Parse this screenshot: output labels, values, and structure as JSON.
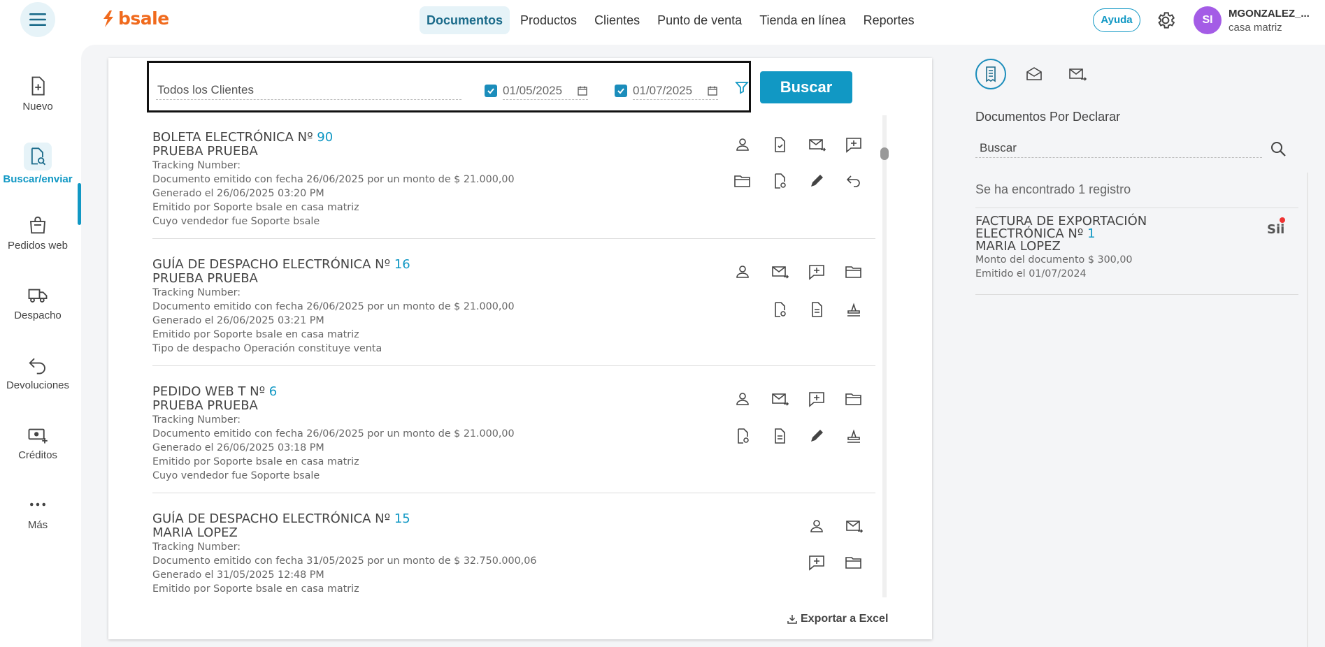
{
  "brand": {
    "logo_text": "bsale",
    "accent": "#1198c4",
    "logo_color": "#f06a1d"
  },
  "topnav": {
    "items": [
      {
        "label": "Documentos",
        "active": true
      },
      {
        "label": "Productos"
      },
      {
        "label": "Clientes"
      },
      {
        "label": "Punto de venta"
      },
      {
        "label": "Tienda en línea"
      },
      {
        "label": "Reportes"
      }
    ],
    "help_label": "Ayuda",
    "user": {
      "initials": "SI",
      "name": "MGONZALEZ_...",
      "branch": "casa matriz"
    }
  },
  "sidebar": {
    "items": [
      {
        "label": "Nuevo",
        "icon": "new-document-icon"
      },
      {
        "label": "Buscar/enviar",
        "icon": "search-document-icon",
        "active": true
      },
      {
        "label": "Pedidos web",
        "icon": "shopping-bag-icon"
      },
      {
        "label": "Despacho",
        "icon": "truck-icon"
      },
      {
        "label": "Devoluciones",
        "icon": "return-arrow-icon"
      },
      {
        "label": "Créditos",
        "icon": "money-icon"
      },
      {
        "label": "Más",
        "icon": "more-dots-icon"
      }
    ]
  },
  "filters": {
    "client_value": "Todos los Clientes",
    "date_from": "01/05/2025",
    "date_to": "01/07/2025",
    "search_label": "Buscar"
  },
  "documents": [
    {
      "title": "BOLETA ELECTRÓNICA Nº ",
      "number": "90",
      "client": "PRUEBA PRUEBA",
      "lines": [
        "Tracking Number:",
        "Documento emitido con fecha 26/06/2025 por un monto de $ 21.000,00",
        "Generado el 26/06/2025 03:20 PM",
        "Emitido por Soporte bsale en casa matriz",
        "Cuyo vendedor fue Soporte bsale"
      ]
    },
    {
      "title": "GUÍA DE DESPACHO ELECTRÓNICA Nº ",
      "number": "16",
      "client": "PRUEBA PRUEBA",
      "lines": [
        "Tracking Number:",
        "Documento emitido con fecha 26/06/2025 por un monto de $ 21.000,00",
        "Generado el 26/06/2025 03:21 PM",
        "Emitido por Soporte bsale en casa matriz",
        "Tipo de despacho Operación constituye venta"
      ]
    },
    {
      "title": "PEDIDO WEB T Nº ",
      "number": "6",
      "client": "PRUEBA PRUEBA",
      "lines": [
        "Tracking Number:",
        "Documento emitido con fecha 26/06/2025 por un monto de $ 21.000,00",
        "Generado el 26/06/2025 03:18 PM",
        "Emitido por Soporte bsale en casa matriz",
        "Cuyo vendedor fue Soporte bsale"
      ]
    },
    {
      "title": "GUÍA DE DESPACHO ELECTRÓNICA Nº ",
      "number": "15",
      "client": "MARIA LOPEZ",
      "lines": [
        "Tracking Number:",
        "Documento emitido con fecha 31/05/2025 por un monto de $ 32.750.000,06",
        "Generado el 31/05/2025 12:48 PM",
        "Emitido por Soporte bsale en casa matriz"
      ]
    }
  ],
  "export_label": "Exportar a Excel",
  "right_panel": {
    "title": "Documentos Por Declarar",
    "search_value": "Buscar",
    "found_text": "Se ha encontrado 1 registro",
    "doc": {
      "title_line1": "FACTURA DE EXPORTACIÓN",
      "title_line2": "ELECTRÓNICA Nº ",
      "number": "1",
      "client": "MARIA LOPEZ",
      "amount": "Monto del documento $ 300,00",
      "issued": "Emitido el 01/07/2024",
      "badge": "Sii"
    }
  }
}
